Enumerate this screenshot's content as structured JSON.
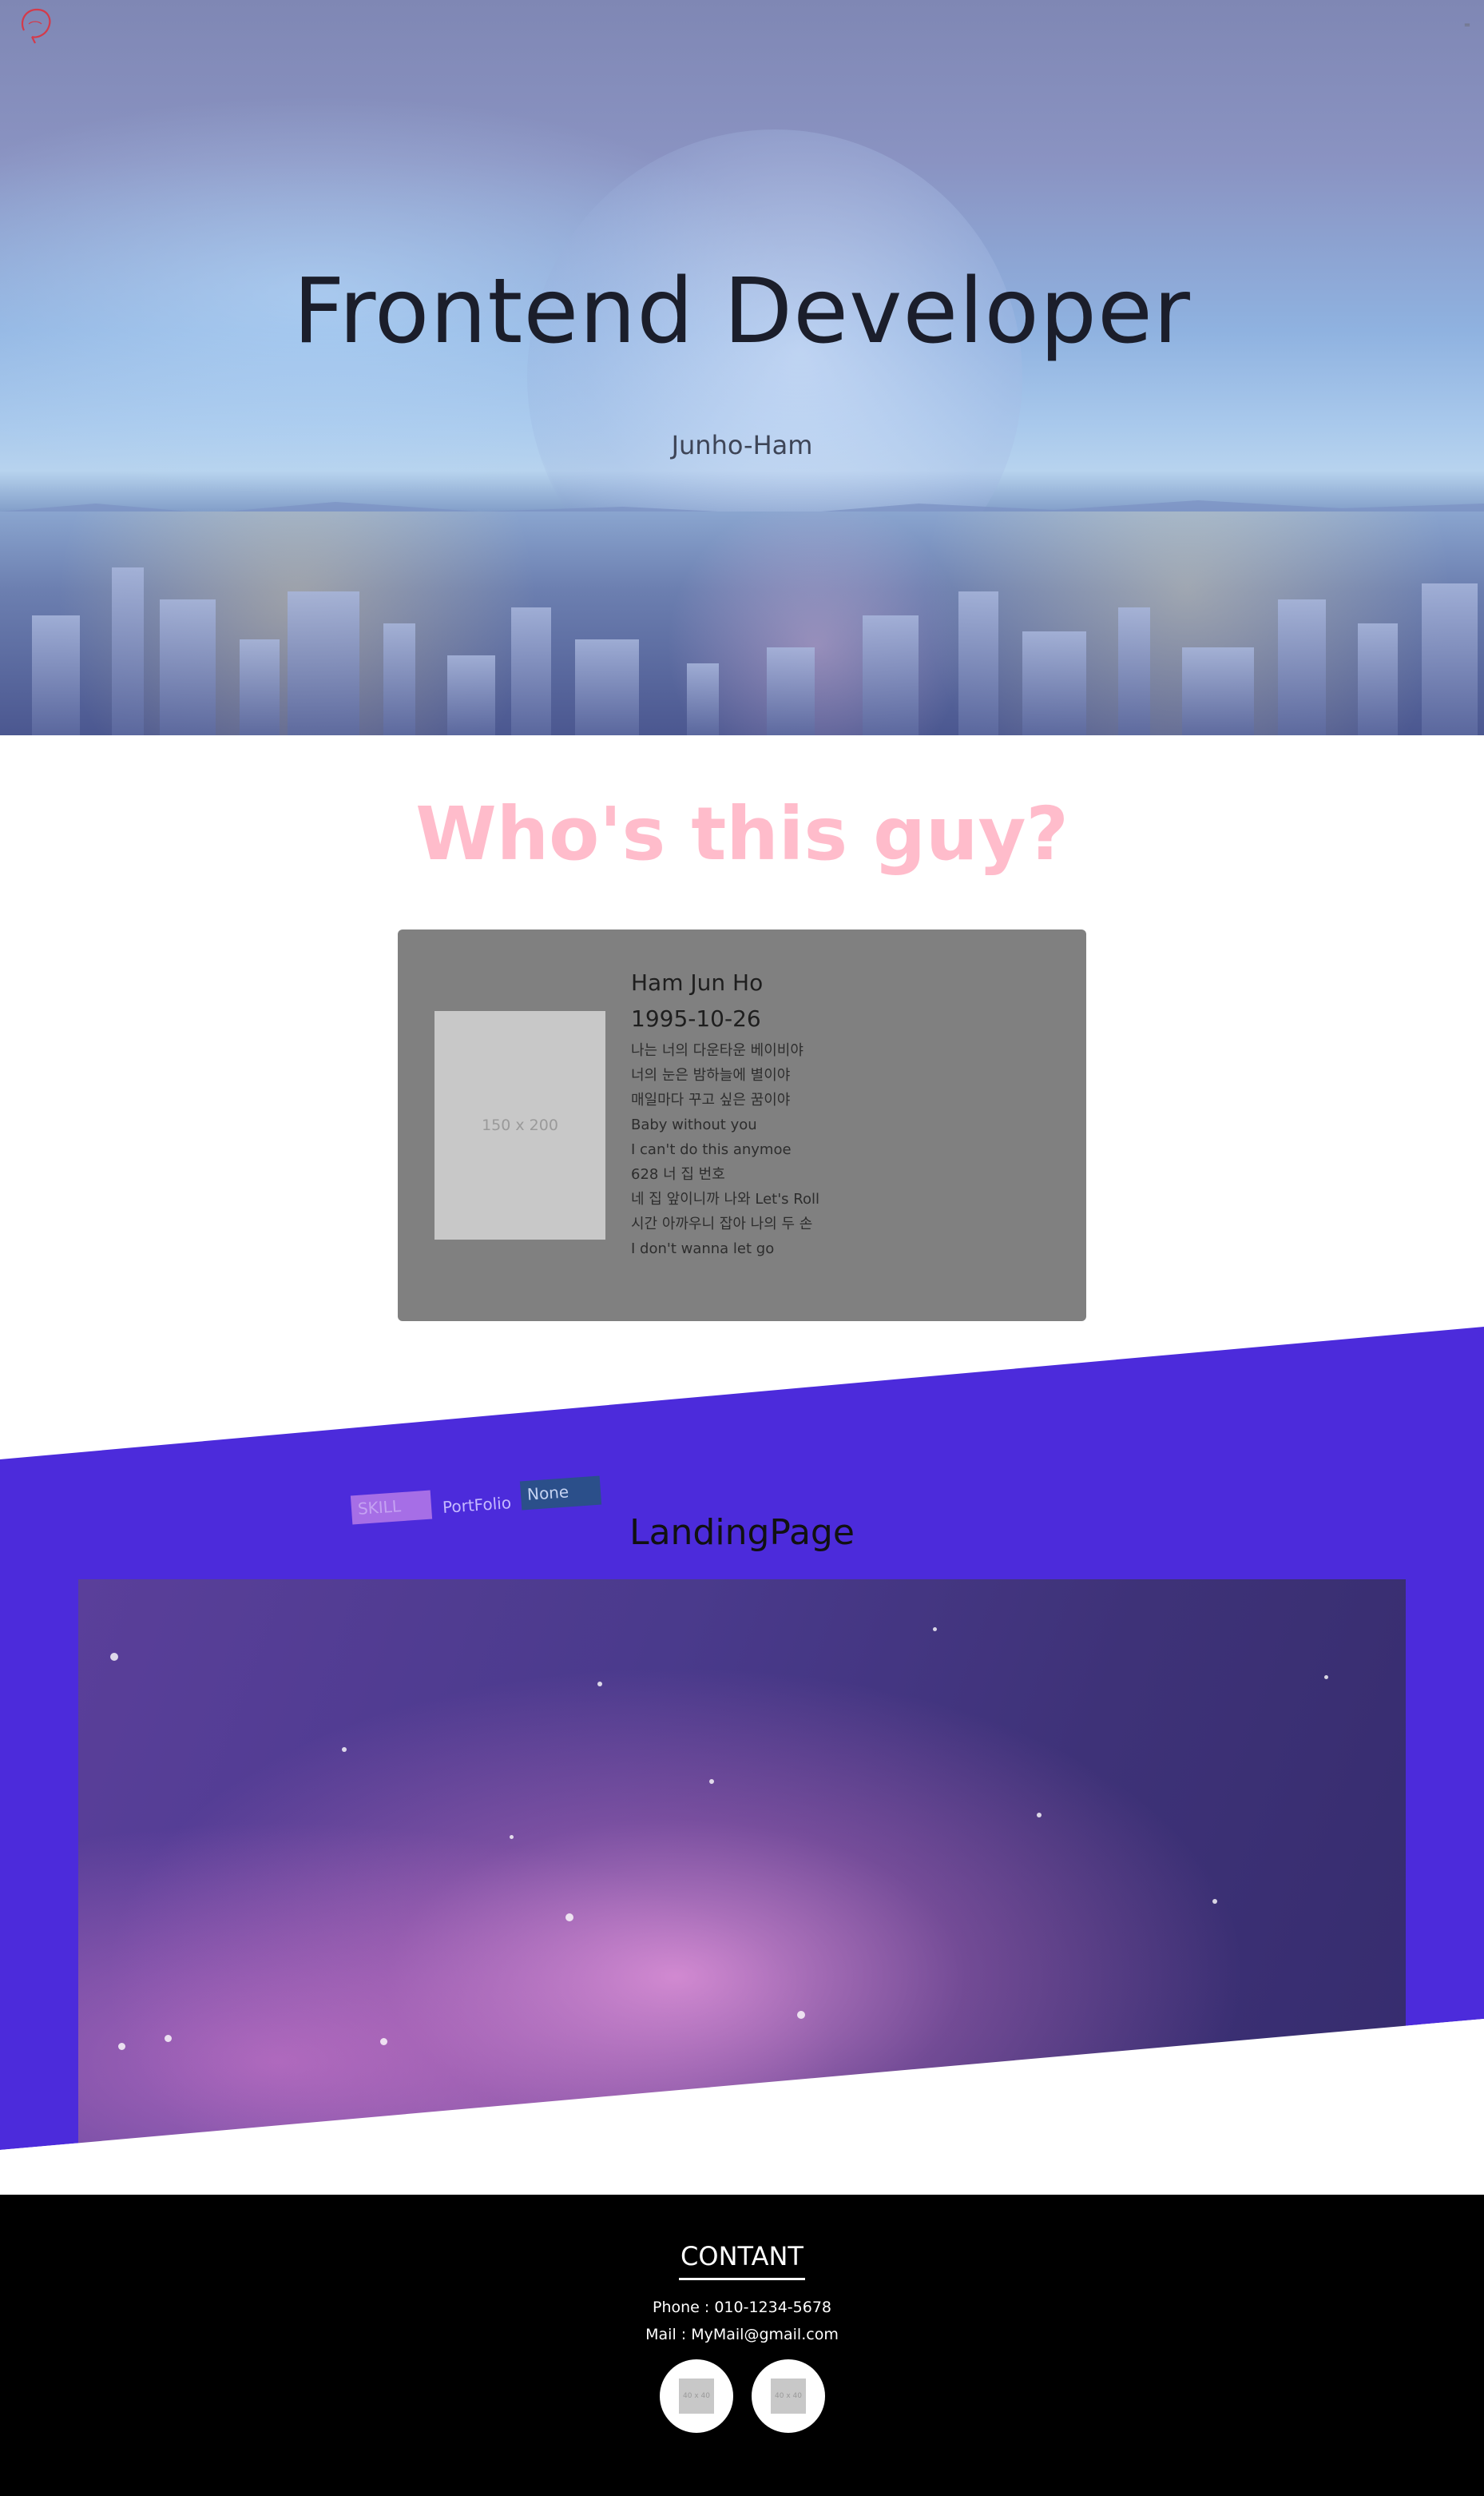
{
  "colors": {
    "accent_pink": "#ffbccb",
    "portfolio_purple": "#4c2bdb",
    "card_gray": "#808080",
    "footer_black": "#000000"
  },
  "hero": {
    "title": "Frontend Developer",
    "subtitle": "Junho-Ham",
    "logo_icon": "circle-signature-logo",
    "menu_icon": "menu-icon"
  },
  "about": {
    "heading": "Who's this guy?",
    "photo_placeholder": "150 x 200",
    "name": "Ham Jun Ho",
    "birthdate": "1995-10-26",
    "lyrics": [
      "나는 너의 다운타운 베이비야",
      "너의 눈은 밤하늘에 별이야",
      "매일마다 꾸고 싶은 꿈이야",
      "Baby without you",
      "I can't do this anymoe",
      "628 너 집 번호",
      "네 집 앞이니까 나와 Let's Roll",
      "시간 아까우니 잡아 나의 두 손",
      "I don't wanna let go"
    ]
  },
  "portfolio": {
    "tabs": [
      {
        "label": "SKILL"
      },
      {
        "label": "PortFolio"
      },
      {
        "label": "None"
      }
    ],
    "project_title": "LandingPage"
  },
  "footer": {
    "heading": "CONTANT",
    "phone": "Phone : 010-1234-5678",
    "mail": "Mail : MyMail@gmail.com",
    "social_placeholder_1": "40 x 40",
    "social_placeholder_2": "40 x 40"
  }
}
